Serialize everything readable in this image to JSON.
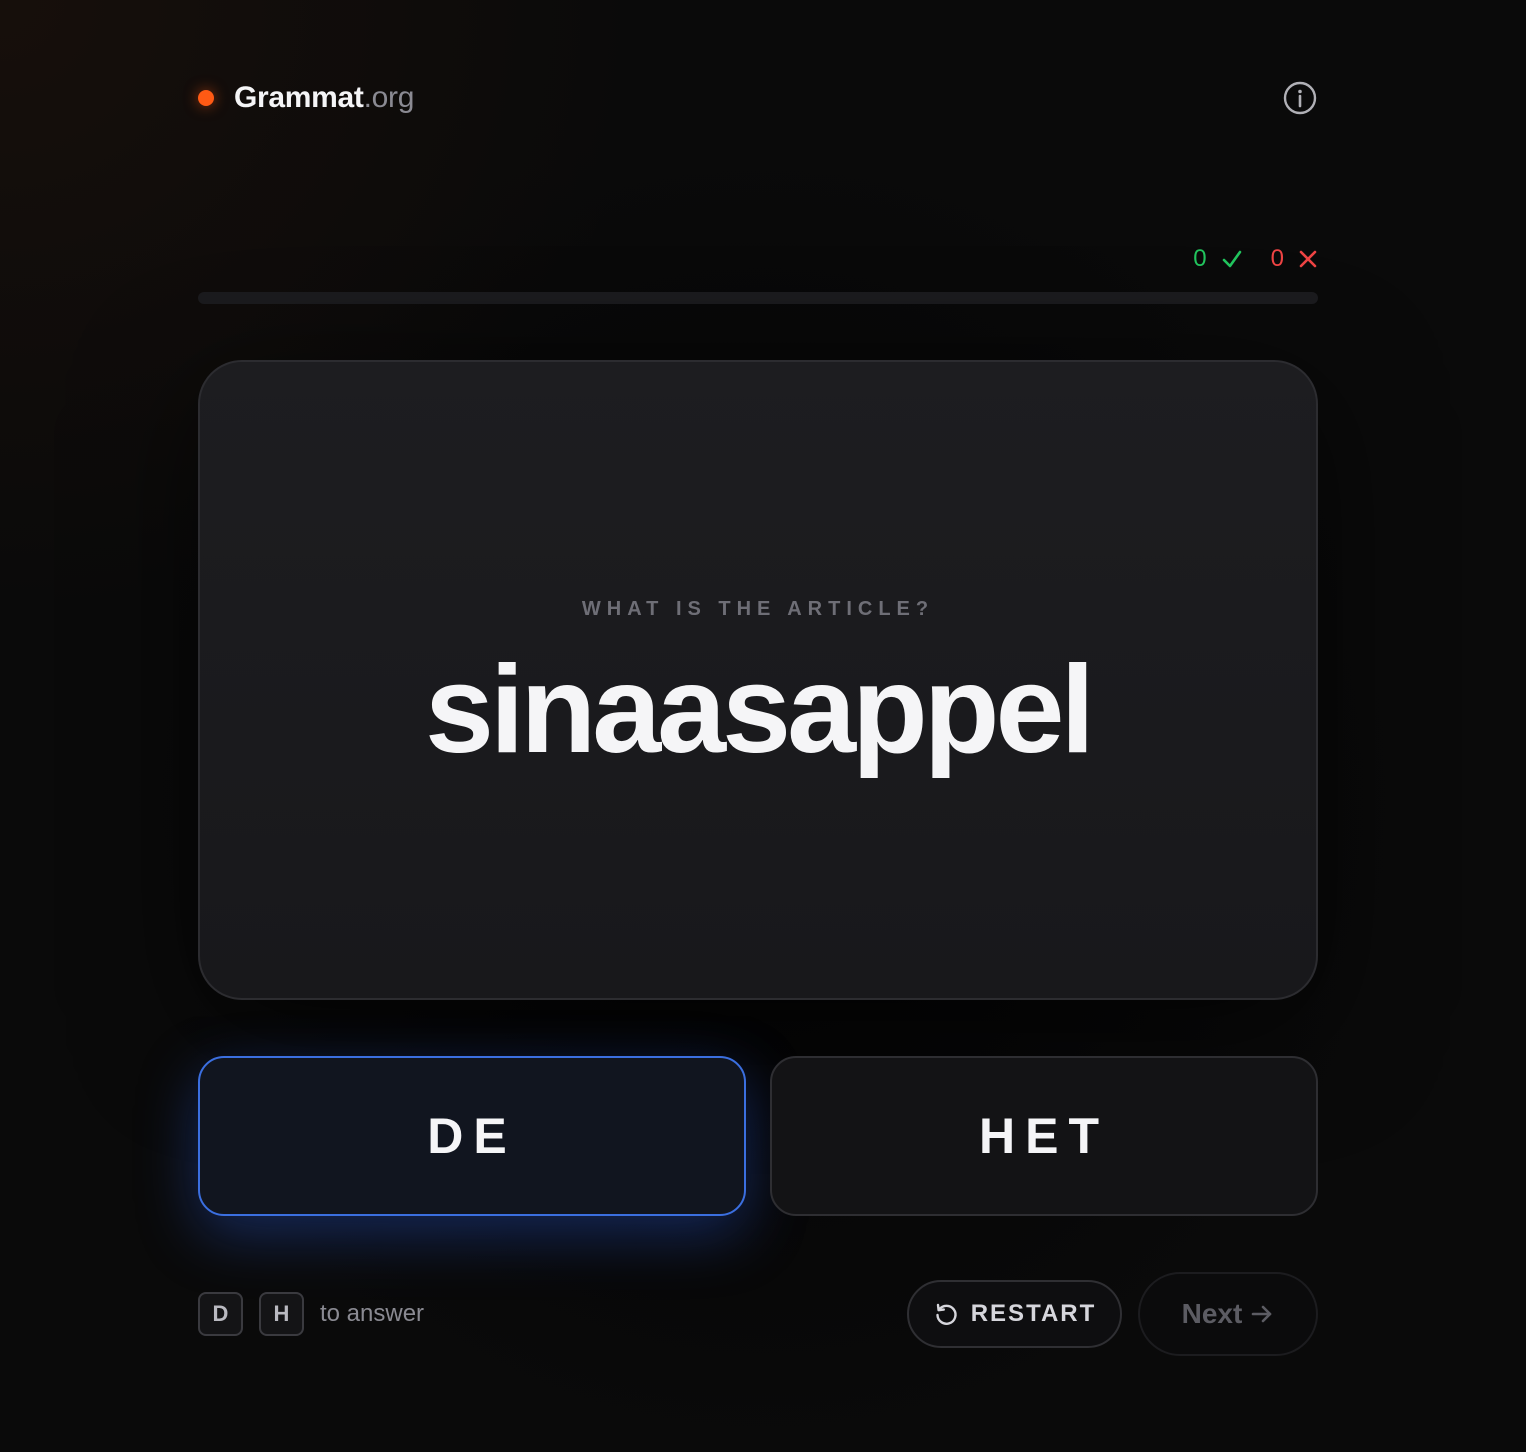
{
  "header": {
    "brand_name": "Grammat",
    "brand_tld": ".org",
    "info_icon": "info-icon"
  },
  "score": {
    "correct": "0",
    "wrong": "0",
    "correct_icon": "check-icon",
    "wrong_icon": "x-icon"
  },
  "progress": {
    "fraction": 0
  },
  "card": {
    "prompt": "WHAT IS THE ARTICLE?",
    "word": "sinaasappel"
  },
  "answers": {
    "de_label": "DE",
    "het_label": "HET"
  },
  "footer": {
    "key_d": "D",
    "key_h": "H",
    "hint_text": "to answer",
    "restart_label": "RESTART",
    "restart_icon": "restart-icon",
    "next_label": "Next",
    "next_icon": "arrow-right-icon"
  },
  "colors": {
    "accent_dot": "#ff5a14",
    "correct": "#22c55e",
    "wrong": "#ef4444",
    "selected_border": "#3b6fe0",
    "background": "#090909"
  }
}
